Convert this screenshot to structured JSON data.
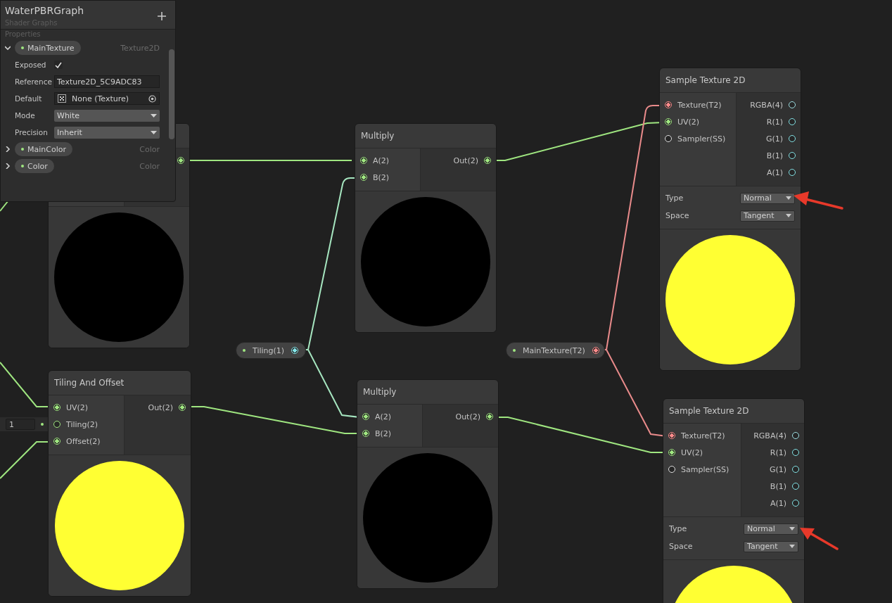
{
  "blackboard": {
    "title": "WaterPBRGraph",
    "subtitle": "Shader Graphs",
    "section": "Properties",
    "properties": [
      {
        "name": "MainTexture",
        "type": "Texture2D",
        "expanded": true,
        "fields": [
          {
            "kind": "checkbox",
            "label": "Exposed",
            "checked": true
          },
          {
            "kind": "text",
            "label": "Reference",
            "value": "Texture2D_5C9ADC83"
          },
          {
            "kind": "object",
            "label": "Default",
            "value": "None (Texture)"
          },
          {
            "kind": "dropdown",
            "label": "Mode",
            "value": "White"
          },
          {
            "kind": "dropdown",
            "label": "Precision",
            "value": "Inherit"
          }
        ]
      },
      {
        "name": "MainColor",
        "type": "Color",
        "expanded": false
      },
      {
        "name": "Color",
        "type": "Color",
        "expanded": false
      }
    ]
  },
  "nodes": [
    {
      "outputs": [
        {
          "kind": "vector2",
          "connected": true
        }
      ],
      "preview": {
        "color": "#000000"
      }
    },
    {
      "title": "Tiling And Offset",
      "inputs": [
        {
          "label": "UV(2)",
          "kind": "vector2",
          "connected": true
        },
        {
          "label": "Tiling(2)",
          "kind": "vector2",
          "connected": false,
          "inline_value": "1"
        },
        {
          "label": "Offset(2)",
          "kind": "vector2",
          "connected": true
        }
      ],
      "outputs": [
        {
          "label": "Out(2)",
          "kind": "vector2",
          "connected": true
        }
      ],
      "preview": {
        "color": "#ffff33"
      }
    },
    {
      "title": "Multiply",
      "inputs": [
        {
          "label": "A(2)",
          "kind": "vector2",
          "connected": true
        },
        {
          "label": "B(2)",
          "kind": "vector2",
          "connected": true
        }
      ],
      "outputs": [
        {
          "label": "Out(2)",
          "kind": "vector2",
          "connected": true
        }
      ],
      "preview": {
        "color": "#000000"
      }
    },
    {
      "title": "Multiply",
      "inputs": [
        {
          "label": "A(2)",
          "kind": "vector2",
          "connected": true
        },
        {
          "label": "B(2)",
          "kind": "vector2",
          "connected": true
        }
      ],
      "outputs": [
        {
          "label": "Out(2)",
          "kind": "vector2",
          "connected": true
        }
      ],
      "preview": {
        "color": "#000000"
      }
    },
    {
      "title": "Sample Texture 2D",
      "inputs": [
        {
          "label": "Texture(T2)",
          "kind": "texture",
          "connected": true
        },
        {
          "label": "UV(2)",
          "kind": "vector2",
          "connected": true
        },
        {
          "label": "Sampler(SS)",
          "kind": "sampler",
          "connected": false
        }
      ],
      "outputs": [
        {
          "label": "RGBA(4)",
          "kind": "vector4",
          "connected": false
        },
        {
          "label": "R(1)",
          "kind": "vector1",
          "connected": false
        },
        {
          "label": "G(1)",
          "kind": "vector1",
          "connected": false
        },
        {
          "label": "B(1)",
          "kind": "vector1",
          "connected": false
        },
        {
          "label": "A(1)",
          "kind": "vector1",
          "connected": false
        }
      ],
      "controls": [
        {
          "label": "Type",
          "value": "Normal"
        },
        {
          "label": "Space",
          "value": "Tangent"
        }
      ],
      "preview": {
        "color": "#ffff33"
      }
    },
    {
      "title": "Sample Texture 2D",
      "inputs": [
        {
          "label": "Texture(T2)",
          "kind": "texture",
          "connected": true
        },
        {
          "label": "UV(2)",
          "kind": "vector2",
          "connected": true
        },
        {
          "label": "Sampler(SS)",
          "kind": "sampler",
          "connected": false
        }
      ],
      "outputs": [
        {
          "label": "RGBA(4)",
          "kind": "vector4",
          "connected": false
        },
        {
          "label": "R(1)",
          "kind": "vector1",
          "connected": false
        },
        {
          "label": "G(1)",
          "kind": "vector1",
          "connected": false
        },
        {
          "label": "B(1)",
          "kind": "vector1",
          "connected": false
        },
        {
          "label": "A(1)",
          "kind": "vector1",
          "connected": false
        }
      ],
      "controls": [
        {
          "label": "Type",
          "value": "Normal"
        },
        {
          "label": "Space",
          "value": "Tangent"
        }
      ],
      "preview": {
        "color": "#ffff33"
      }
    }
  ],
  "property_nodes": [
    {
      "label": "Tiling(1)",
      "kind": "vector1"
    },
    {
      "label": "MainTexture(T2)",
      "kind": "texture"
    }
  ]
}
